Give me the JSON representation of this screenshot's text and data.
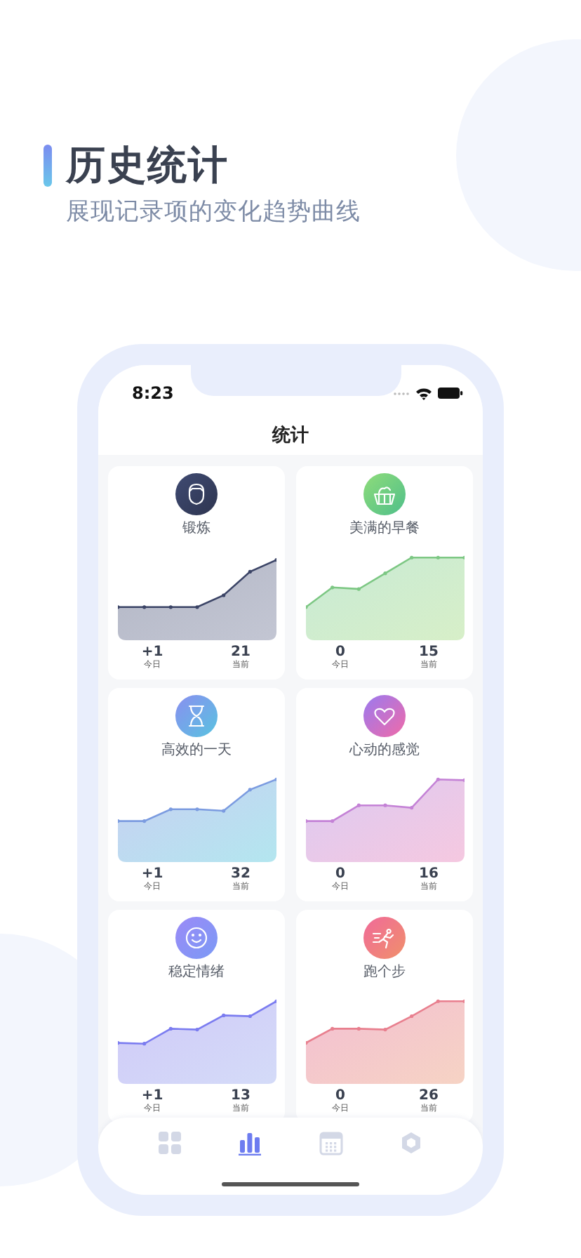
{
  "header": {
    "title": "历史统计",
    "subtitle": "展现记录项的变化趋势曲线"
  },
  "status_bar": {
    "time": "8:23"
  },
  "nav": {
    "title": "统计"
  },
  "cards": [
    {
      "kind": "face",
      "name": "锻炼",
      "color": "#3b4466",
      "today": "+1",
      "today_label": "今日",
      "current": "21",
      "current_label": "当前"
    },
    {
      "kind": "basket",
      "name": "美满的早餐",
      "color": "#7cc783",
      "today": "0",
      "today_label": "今日",
      "current": "15",
      "current_label": "当前"
    },
    {
      "kind": "hourglass",
      "name": "高效的一天",
      "color": "#7b9be0",
      "today": "+1",
      "today_label": "今日",
      "current": "32",
      "current_label": "当前"
    },
    {
      "kind": "heart",
      "name": "心动的感觉",
      "color": "#c482d6",
      "today": "0",
      "today_label": "今日",
      "current": "16",
      "current_label": "当前"
    },
    {
      "kind": "smile",
      "name": "稳定情绪",
      "color": "#7b7cf0",
      "today": "+1",
      "today_label": "今日",
      "current": "13",
      "current_label": "当前"
    },
    {
      "kind": "runner",
      "name": "跑个步",
      "color": "#e87f8e",
      "today": "0",
      "today_label": "今日",
      "current": "26",
      "current_label": "当前"
    }
  ],
  "tabs": [
    {
      "kind": "grid",
      "selected": false
    },
    {
      "kind": "chart",
      "selected": true
    },
    {
      "kind": "calendar",
      "selected": false
    },
    {
      "kind": "hexagon",
      "selected": false
    }
  ]
}
